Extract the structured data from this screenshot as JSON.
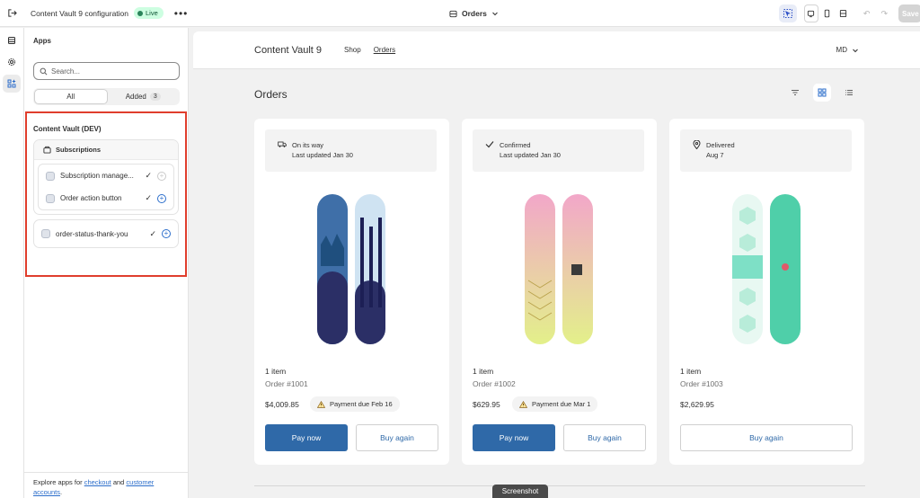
{
  "topbar": {
    "title": "Content Vault 9 configuration",
    "status_badge": "Live",
    "more_label": "•••",
    "page_selector": "Orders",
    "save_label": "Save"
  },
  "sidebar": {
    "title": "Apps",
    "search_placeholder": "Search...",
    "tabs": [
      {
        "label": "All",
        "active": true
      },
      {
        "label": "Added",
        "count": "3",
        "active": false
      }
    ],
    "section_title": "Content Vault (DEV)",
    "group": {
      "title": "Subscriptions",
      "items": [
        {
          "label": "Subscription manage...",
          "added": true,
          "can_add": false
        },
        {
          "label": "Order action button",
          "added": true,
          "can_add": true
        }
      ]
    },
    "standalone_items": [
      {
        "label": "order-status-thank-you",
        "added": true,
        "can_add": true
      }
    ],
    "footer": {
      "prefix": "Explore apps for ",
      "link1": "checkout",
      "mid": " and ",
      "link2": "customer accounts",
      "suffix": "."
    }
  },
  "store": {
    "name": "Content Vault 9",
    "nav": [
      {
        "label": "Shop"
      },
      {
        "label": "Orders"
      }
    ],
    "account_initials": "MD",
    "page_title": "Orders",
    "orders": [
      {
        "status": "On its way",
        "status_sub": "Last updated Jan 30",
        "status_icon": "truck-icon",
        "items": "1 item",
        "order_number": "Order #1001",
        "price": "$4,009.85",
        "payment_due": "Payment due Feb 16",
        "primary_action": "Pay now",
        "secondary_action": "Buy again",
        "board_colors": {
          "a": "#3f6fa8",
          "b": "#cfe3f2",
          "c": "#2b2f66"
        }
      },
      {
        "status": "Confirmed",
        "status_sub": "Last updated Jan 30",
        "status_icon": "check-icon",
        "items": "1 item",
        "order_number": "Order #1002",
        "price": "$629.95",
        "payment_due": "Payment due Mar 1",
        "primary_action": "Pay now",
        "secondary_action": "Buy again",
        "board_colors": {
          "a": "#f2a7c9",
          "b": "#e3f08a",
          "c": "#f5d0e6"
        }
      },
      {
        "status": "Delivered",
        "status_sub": "Aug 7",
        "status_icon": "location-pin-icon",
        "items": "1 item",
        "order_number": "Order #1003",
        "price": "$2,629.95",
        "payment_due": "",
        "primary_action": "",
        "secondary_action": "Buy again",
        "board_colors": {
          "a": "#b8ecd9",
          "b": "#4fcfa9",
          "c": "#7ee0c6"
        }
      }
    ]
  },
  "tooltip": "Screenshot",
  "colors": {
    "accent": "#2f69a8",
    "highlight_border": "#e03e2d",
    "live_badge": "#cdfee1"
  }
}
